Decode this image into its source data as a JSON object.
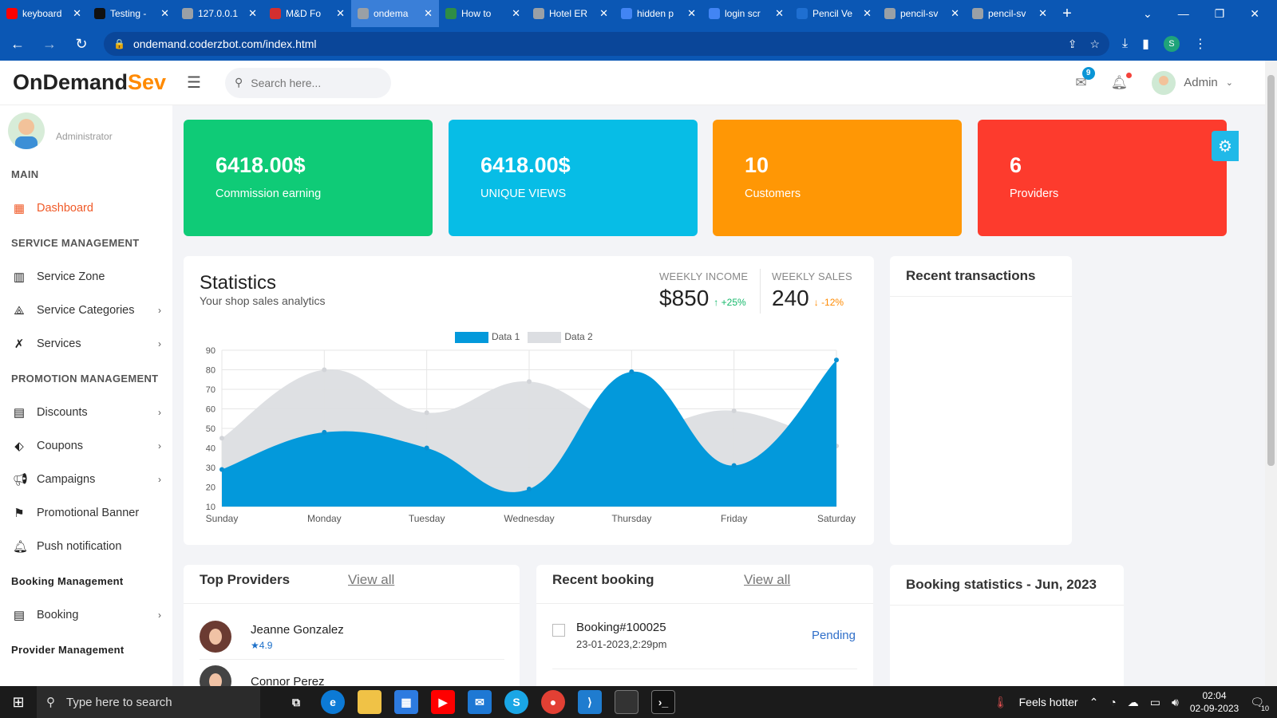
{
  "browser": {
    "tabs": [
      {
        "title": "keyboard",
        "color": "#ff0000"
      },
      {
        "title": "Testing -",
        "color": "#111111"
      },
      {
        "title": "127.0.0.1",
        "color": "#9aa0a6"
      },
      {
        "title": "M&D Fo",
        "color": "#d32f2f"
      },
      {
        "title": "ondema",
        "color": "#9aa0a6",
        "active": true
      },
      {
        "title": "How to",
        "color": "#2f8d46"
      },
      {
        "title": "Hotel ER",
        "color": "#9aa0a6"
      },
      {
        "title": "hidden p",
        "color": "#4285f4"
      },
      {
        "title": "login scr",
        "color": "#4285f4"
      },
      {
        "title": "Pencil Ve",
        "color": "#1f6fd1"
      },
      {
        "title": "pencil-sv",
        "color": "#9aa0a6"
      },
      {
        "title": "pencil-sv",
        "color": "#9aa0a6"
      }
    ],
    "url": "ondemand.coderzbot.com/index.html",
    "profile_initial": "S"
  },
  "header": {
    "logo_main": "OnDemand",
    "logo_accent": "Sev",
    "search_placeholder": "Search here...",
    "mail_badge": "9",
    "user_name": "Admin"
  },
  "sidebar": {
    "role": "Administrator",
    "sections": [
      {
        "title": "MAIN",
        "items": [
          {
            "label": "Dashboard",
            "icon": "grid-icon",
            "active": true
          }
        ]
      },
      {
        "title": "SERVICE MANAGEMENT",
        "items": [
          {
            "label": "Service Zone",
            "icon": "map-icon"
          },
          {
            "label": "Service Categories",
            "icon": "shapes-icon",
            "chevron": true
          },
          {
            "label": "Services",
            "icon": "tools-icon",
            "chevron": true
          }
        ]
      },
      {
        "title": "PROMOTION MANAGEMENT",
        "items": [
          {
            "label": "Discounts",
            "icon": "calendar-icon",
            "chevron": true
          },
          {
            "label": "Coupons",
            "icon": "tag-icon",
            "chevron": true
          },
          {
            "label": "Campaigns",
            "icon": "megaphone-icon",
            "chevron": true
          },
          {
            "label": "Promotional Banner",
            "icon": "flag-icon"
          },
          {
            "label": "Push notification",
            "icon": "bell-icon"
          }
        ]
      },
      {
        "title": "Booking Management",
        "items": [
          {
            "label": "Booking",
            "icon": "calendar-icon",
            "chevron": true
          }
        ]
      },
      {
        "title": "Provider Management",
        "items": []
      }
    ]
  },
  "cards": [
    {
      "value": "6418.00$",
      "label": "Commission earning",
      "color": "#0fcb77"
    },
    {
      "value": "6418.00$",
      "label": "UNIQUE VIEWS",
      "color": "#07bde6"
    },
    {
      "value": "10",
      "label": "Customers",
      "color": "#ff9705"
    },
    {
      "value": "6",
      "label": "Providers",
      "color": "#fd3b2d"
    }
  ],
  "statistics": {
    "title": "Statistics",
    "subtitle": "Your shop sales analytics",
    "weekly_income_label": "WEEKLY INCOME",
    "weekly_income": "$850",
    "weekly_income_change": "+25%",
    "weekly_sales_label": "WEEKLY SALES",
    "weekly_sales": "240",
    "weekly_sales_change": "-12%"
  },
  "chart_data": {
    "type": "area",
    "categories": [
      "Sunday",
      "Monday",
      "Tuesday",
      "Wednesday",
      "Thursday",
      "Friday",
      "Saturday"
    ],
    "series": [
      {
        "name": "Data 1",
        "values": [
          29,
          48,
          40,
          19,
          79,
          31,
          85
        ],
        "color": "#0399db"
      },
      {
        "name": "Data 2",
        "values": [
          45,
          80,
          58,
          74,
          51,
          59,
          41
        ],
        "color": "#dcdee2"
      }
    ],
    "ylim": [
      10,
      90
    ],
    "yticks": [
      10,
      20,
      30,
      40,
      50,
      60,
      70,
      80,
      90
    ],
    "grid": true,
    "legend": "top-center"
  },
  "recent_transactions": {
    "title": "Recent transactions"
  },
  "top_providers": {
    "title": "Top Providers",
    "view_all": "View all",
    "items": [
      {
        "name": "Jeanne Gonzalez",
        "rating": "4.9"
      },
      {
        "name": "Connor Perez"
      }
    ]
  },
  "recent_booking": {
    "title": "Recent booking",
    "view_all": "View all",
    "items": [
      {
        "id": "Booking#100025",
        "date": "23-01-2023,2:29pm",
        "status": "Pending"
      }
    ]
  },
  "booking_statistics": {
    "title": "Booking statistics - Jun, 2023"
  },
  "taskbar": {
    "search_placeholder": "Type here to search",
    "weather": "Feels hotter",
    "time": "02:04",
    "date": "02-09-2023",
    "notifications": "10"
  }
}
